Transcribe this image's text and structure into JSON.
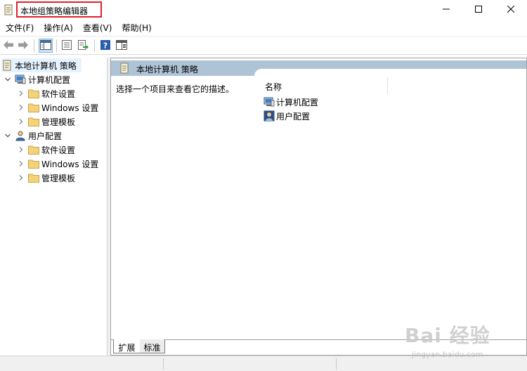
{
  "window": {
    "title": "本地组策略编辑器",
    "highlight_color": "#e0202a"
  },
  "menu": {
    "items": [
      {
        "label": "文件(F)"
      },
      {
        "label": "操作(A)"
      },
      {
        "label": "查看(V)"
      },
      {
        "label": "帮助(H)"
      }
    ]
  },
  "toolbar": {
    "buttons": [
      "back-arrow-icon",
      "forward-arrow-icon",
      "show-hide-console-tree-icon",
      "properties-icon",
      "export-list-icon",
      "help-icon",
      "show-hide-action-pane-icon"
    ]
  },
  "tree": {
    "root": {
      "label": "本地计算机 策略"
    },
    "computer": {
      "label": "计算机配置",
      "children": [
        {
          "label": "软件设置"
        },
        {
          "label": "Windows 设置"
        },
        {
          "label": "管理模板"
        }
      ]
    },
    "user": {
      "label": "用户配置",
      "children": [
        {
          "label": "软件设置"
        },
        {
          "label": "Windows 设置"
        },
        {
          "label": "管理模板"
        }
      ]
    }
  },
  "details": {
    "header": "本地计算机 策略",
    "description": "选择一个项目来查看它的描述。",
    "column_name": "名称",
    "items": [
      {
        "label": "计算机配置"
      },
      {
        "label": "用户配置"
      }
    ],
    "header_color": "#afc3d6"
  },
  "tabs": {
    "expand": "扩展",
    "standard": "标准"
  },
  "watermark": {
    "main": "Bai 经验",
    "sub": "jingyan.baidu.com"
  }
}
